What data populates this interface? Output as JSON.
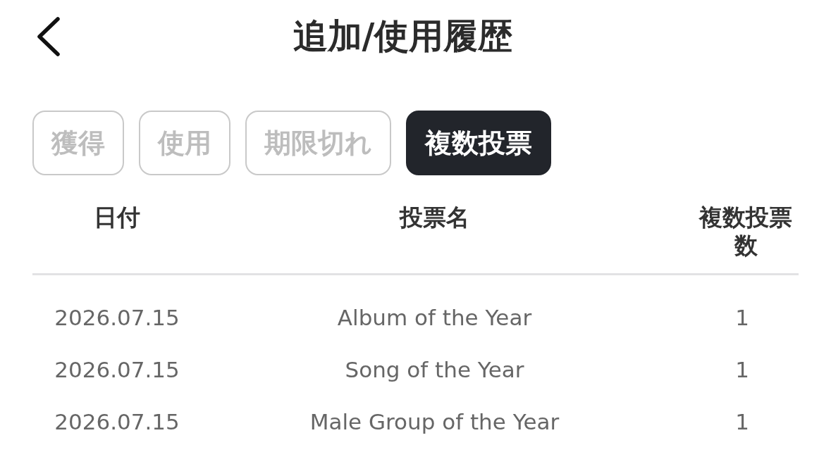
{
  "header": {
    "title": "追加/使用履歴"
  },
  "tabs": [
    {
      "label": "獲得",
      "selected": false
    },
    {
      "label": "使用",
      "selected": false
    },
    {
      "label": "期限切れ",
      "selected": false
    },
    {
      "label": "複数投票",
      "selected": true
    }
  ],
  "table": {
    "columns": [
      "日付",
      "投票名",
      "複数投票数"
    ],
    "rows": [
      [
        "2026.07.15",
        "Album of the Year",
        "1"
      ],
      [
        "2026.07.15",
        "Song of the Year",
        "1"
      ],
      [
        "2026.07.15",
        "Male Group of the Year",
        "1"
      ]
    ]
  }
}
